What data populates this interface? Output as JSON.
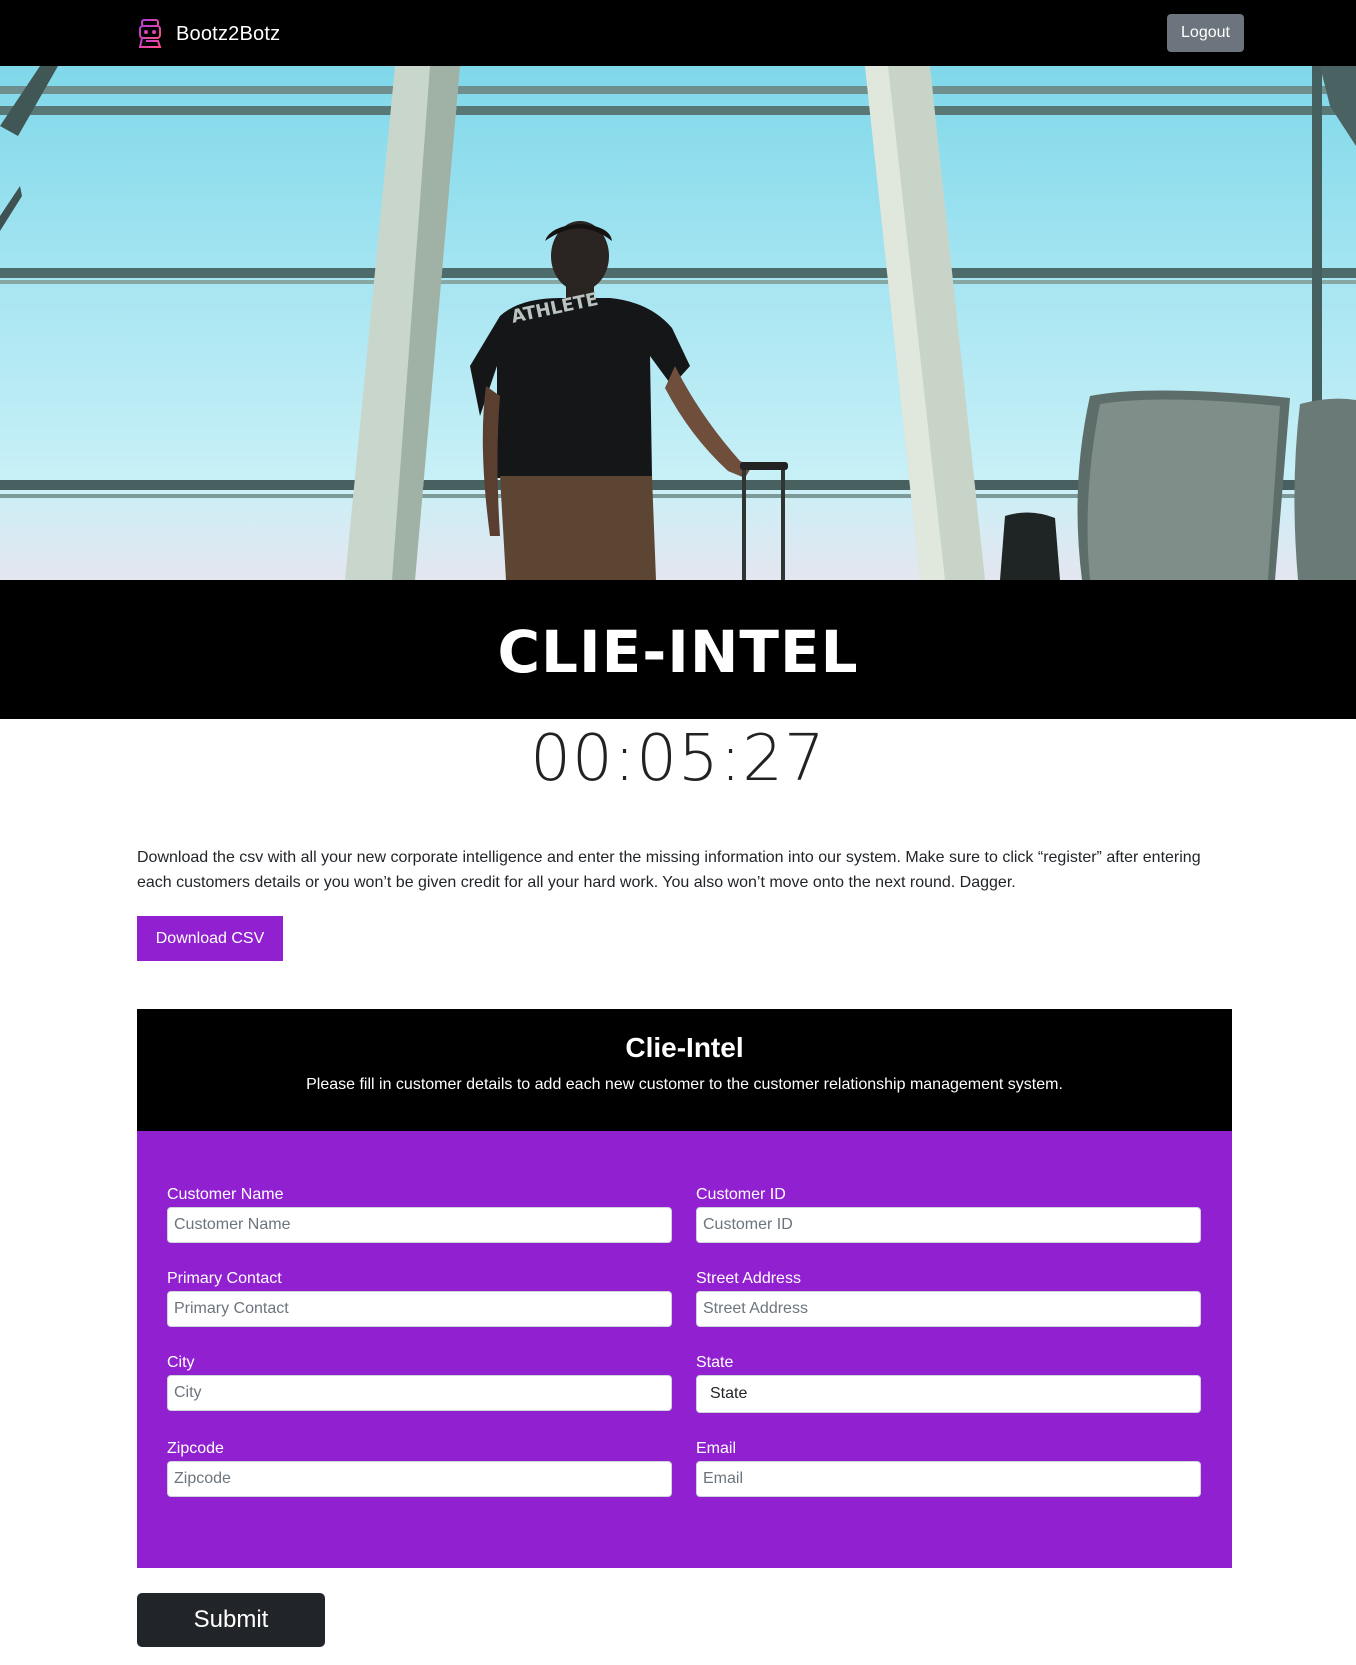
{
  "navbar": {
    "brand": "Bootz2Botz",
    "logout_label": "Logout"
  },
  "hero": {
    "image": "person-with-suitcase-at-airport-window",
    "shirt_text": "ATHLETE"
  },
  "title": "CLIE-INTEL",
  "timer": "00:05:27",
  "intro": {
    "text": "Download the csv with all your new corporate intelligence and enter the missing information into our system. Make sure to click “register” after entering each customers details or you won’t be given credit for all your hard work. You also won’t move onto the next round. Dagger.",
    "download_label": "Download CSV"
  },
  "form": {
    "title": "Clie-Intel",
    "subtitle": "Please fill in customer details to add each new customer to the customer relationship management system.",
    "fields": {
      "customer_name": {
        "label": "Customer Name",
        "placeholder": "Customer Name"
      },
      "customer_id": {
        "label": "Customer ID",
        "placeholder": "Customer ID"
      },
      "primary_contact": {
        "label": "Primary Contact",
        "placeholder": "Primary Contact"
      },
      "street_address": {
        "label": "Street Address",
        "placeholder": "Street Address"
      },
      "city": {
        "label": "City",
        "placeholder": "City"
      },
      "state": {
        "label": "State",
        "value": "State"
      },
      "zipcode": {
        "label": "Zipcode",
        "placeholder": "Zipcode"
      },
      "email": {
        "label": "Email",
        "placeholder": "Email"
      }
    },
    "submit_label": "Submit"
  },
  "colors": {
    "accent_purple": "#9121d0",
    "navbar_bg": "#000000",
    "logout_bg": "#6c757d",
    "submit_bg": "#212529",
    "brand_icon": "#e0449e"
  }
}
